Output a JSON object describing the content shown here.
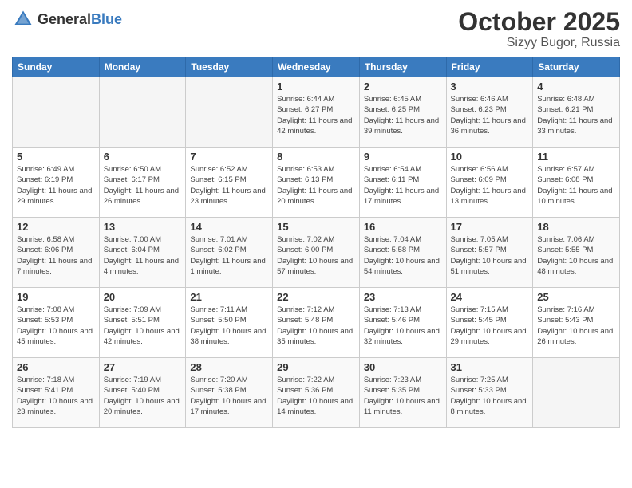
{
  "header": {
    "logo_general": "General",
    "logo_blue": "Blue",
    "month": "October 2025",
    "location": "Sizyy Bugor, Russia"
  },
  "days_of_week": [
    "Sunday",
    "Monday",
    "Tuesday",
    "Wednesday",
    "Thursday",
    "Friday",
    "Saturday"
  ],
  "weeks": [
    [
      {
        "day": "",
        "info": ""
      },
      {
        "day": "",
        "info": ""
      },
      {
        "day": "",
        "info": ""
      },
      {
        "day": "1",
        "sunrise": "6:44 AM",
        "sunset": "6:27 PM",
        "daylight": "11 hours and 42 minutes."
      },
      {
        "day": "2",
        "sunrise": "6:45 AM",
        "sunset": "6:25 PM",
        "daylight": "11 hours and 39 minutes."
      },
      {
        "day": "3",
        "sunrise": "6:46 AM",
        "sunset": "6:23 PM",
        "daylight": "11 hours and 36 minutes."
      },
      {
        "day": "4",
        "sunrise": "6:48 AM",
        "sunset": "6:21 PM",
        "daylight": "11 hours and 33 minutes."
      }
    ],
    [
      {
        "day": "5",
        "sunrise": "6:49 AM",
        "sunset": "6:19 PM",
        "daylight": "11 hours and 29 minutes."
      },
      {
        "day": "6",
        "sunrise": "6:50 AM",
        "sunset": "6:17 PM",
        "daylight": "11 hours and 26 minutes."
      },
      {
        "day": "7",
        "sunrise": "6:52 AM",
        "sunset": "6:15 PM",
        "daylight": "11 hours and 23 minutes."
      },
      {
        "day": "8",
        "sunrise": "6:53 AM",
        "sunset": "6:13 PM",
        "daylight": "11 hours and 20 minutes."
      },
      {
        "day": "9",
        "sunrise": "6:54 AM",
        "sunset": "6:11 PM",
        "daylight": "11 hours and 17 minutes."
      },
      {
        "day": "10",
        "sunrise": "6:56 AM",
        "sunset": "6:09 PM",
        "daylight": "11 hours and 13 minutes."
      },
      {
        "day": "11",
        "sunrise": "6:57 AM",
        "sunset": "6:08 PM",
        "daylight": "11 hours and 10 minutes."
      }
    ],
    [
      {
        "day": "12",
        "sunrise": "6:58 AM",
        "sunset": "6:06 PM",
        "daylight": "11 hours and 7 minutes."
      },
      {
        "day": "13",
        "sunrise": "7:00 AM",
        "sunset": "6:04 PM",
        "daylight": "11 hours and 4 minutes."
      },
      {
        "day": "14",
        "sunrise": "7:01 AM",
        "sunset": "6:02 PM",
        "daylight": "11 hours and 1 minute."
      },
      {
        "day": "15",
        "sunrise": "7:02 AM",
        "sunset": "6:00 PM",
        "daylight": "10 hours and 57 minutes."
      },
      {
        "day": "16",
        "sunrise": "7:04 AM",
        "sunset": "5:58 PM",
        "daylight": "10 hours and 54 minutes."
      },
      {
        "day": "17",
        "sunrise": "7:05 AM",
        "sunset": "5:57 PM",
        "daylight": "10 hours and 51 minutes."
      },
      {
        "day": "18",
        "sunrise": "7:06 AM",
        "sunset": "5:55 PM",
        "daylight": "10 hours and 48 minutes."
      }
    ],
    [
      {
        "day": "19",
        "sunrise": "7:08 AM",
        "sunset": "5:53 PM",
        "daylight": "10 hours and 45 minutes."
      },
      {
        "day": "20",
        "sunrise": "7:09 AM",
        "sunset": "5:51 PM",
        "daylight": "10 hours and 42 minutes."
      },
      {
        "day": "21",
        "sunrise": "7:11 AM",
        "sunset": "5:50 PM",
        "daylight": "10 hours and 38 minutes."
      },
      {
        "day": "22",
        "sunrise": "7:12 AM",
        "sunset": "5:48 PM",
        "daylight": "10 hours and 35 minutes."
      },
      {
        "day": "23",
        "sunrise": "7:13 AM",
        "sunset": "5:46 PM",
        "daylight": "10 hours and 32 minutes."
      },
      {
        "day": "24",
        "sunrise": "7:15 AM",
        "sunset": "5:45 PM",
        "daylight": "10 hours and 29 minutes."
      },
      {
        "day": "25",
        "sunrise": "7:16 AM",
        "sunset": "5:43 PM",
        "daylight": "10 hours and 26 minutes."
      }
    ],
    [
      {
        "day": "26",
        "sunrise": "7:18 AM",
        "sunset": "5:41 PM",
        "daylight": "10 hours and 23 minutes."
      },
      {
        "day": "27",
        "sunrise": "7:19 AM",
        "sunset": "5:40 PM",
        "daylight": "10 hours and 20 minutes."
      },
      {
        "day": "28",
        "sunrise": "7:20 AM",
        "sunset": "5:38 PM",
        "daylight": "10 hours and 17 minutes."
      },
      {
        "day": "29",
        "sunrise": "7:22 AM",
        "sunset": "5:36 PM",
        "daylight": "10 hours and 14 minutes."
      },
      {
        "day": "30",
        "sunrise": "7:23 AM",
        "sunset": "5:35 PM",
        "daylight": "10 hours and 11 minutes."
      },
      {
        "day": "31",
        "sunrise": "7:25 AM",
        "sunset": "5:33 PM",
        "daylight": "10 hours and 8 minutes."
      },
      {
        "day": "",
        "info": ""
      }
    ]
  ]
}
